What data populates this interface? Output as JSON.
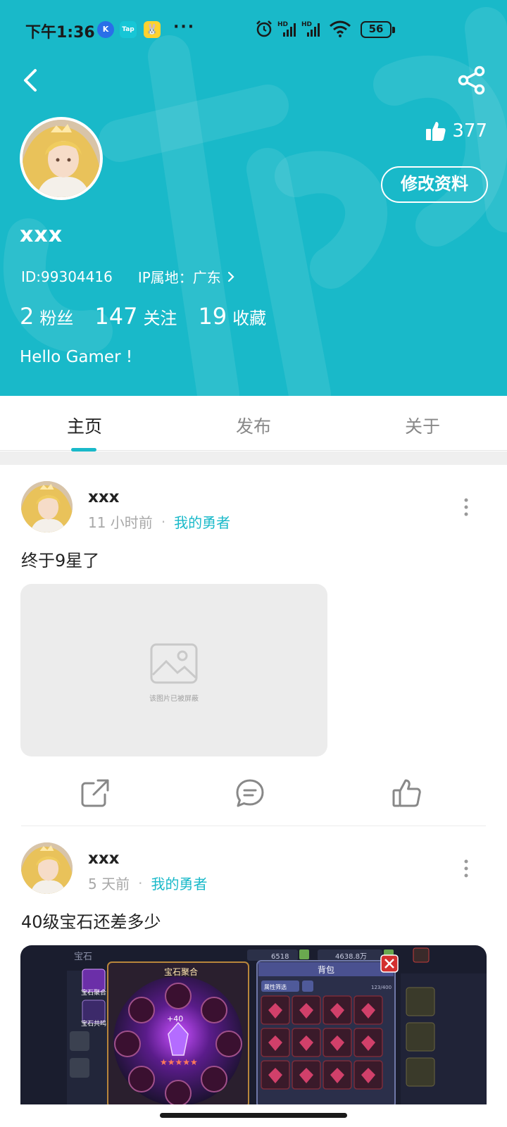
{
  "status_bar": {
    "time": "下午1:36",
    "app_icons": [
      "K",
      "Tap",
      "🐰"
    ],
    "more": "···",
    "battery": "56"
  },
  "profile": {
    "likes": "377",
    "edit_label": "修改资料",
    "username": "xxx",
    "id_text": "ID:99304416",
    "ip_text": "IP属地：广东",
    "stats": [
      {
        "num": "2",
        "label": "粉丝"
      },
      {
        "num": "147",
        "label": "关注"
      },
      {
        "num": "19",
        "label": "收藏"
      }
    ],
    "bio": "Hello Gamer !"
  },
  "tabs": [
    {
      "label": "主页",
      "active": true
    },
    {
      "label": "发布",
      "active": false
    },
    {
      "label": "关于",
      "active": false
    }
  ],
  "posts": [
    {
      "author": "xxx",
      "time": "11 小时前",
      "game": "我的勇者",
      "text": "终于9星了",
      "blocked_note": "该图片已被屏蔽"
    },
    {
      "author": "xxx",
      "time": "5 天前",
      "game": "我的勇者",
      "text": "40级宝石还差多少",
      "screenshot": {
        "tab_gem": "宝石",
        "fuse_title": "宝石聚合",
        "bag_title": "背包",
        "filter_label": "属性筛选",
        "side_labels": [
          "宝石聚合",
          "宝石共鸣"
        ],
        "gem_count": "6518",
        "gold": "4638.8万",
        "capacity": "123/400",
        "center_level": "+40"
      }
    }
  ],
  "colors": {
    "accent": "#19b9c9",
    "text": "#222222",
    "muted": "#a8a8a8"
  }
}
